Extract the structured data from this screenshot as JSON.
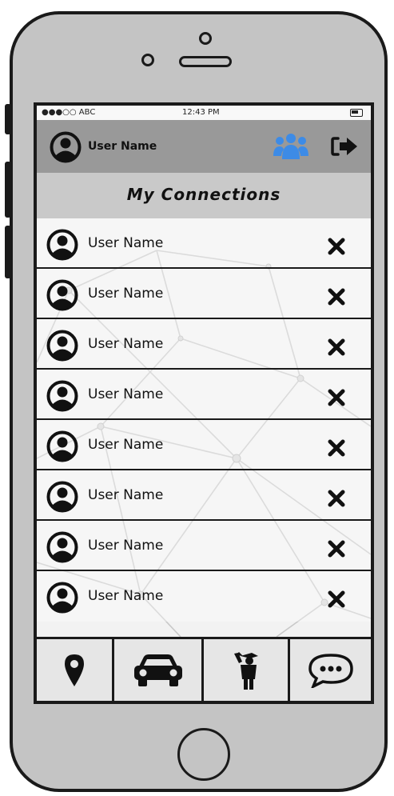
{
  "status_bar": {
    "carrier": "●●●○○ ABC",
    "time": "12:43 PM"
  },
  "header": {
    "user_name": "User Name",
    "group_icon": "group-icon",
    "signout_icon": "sign-out-icon"
  },
  "page": {
    "title": "My Connections"
  },
  "connections": [
    {
      "name": "User Name",
      "remove_icon": "close-icon"
    },
    {
      "name": "User Name",
      "remove_icon": "close-icon"
    },
    {
      "name": "User Name",
      "remove_icon": "close-icon"
    },
    {
      "name": "User Name",
      "remove_icon": "close-icon"
    },
    {
      "name": "User Name",
      "remove_icon": "close-icon"
    },
    {
      "name": "User Name",
      "remove_icon": "close-icon"
    },
    {
      "name": "User Name",
      "remove_icon": "close-icon"
    },
    {
      "name": "User Name",
      "remove_icon": "close-icon"
    }
  ],
  "tabs": [
    {
      "icon": "map-marker-icon"
    },
    {
      "icon": "car-icon"
    },
    {
      "icon": "graduate-icon"
    },
    {
      "icon": "chat-bubble-icon"
    }
  ],
  "colors": {
    "header_bg": "#999999",
    "group_icon": "#3d8be6",
    "frame": "#1a1a1a"
  }
}
